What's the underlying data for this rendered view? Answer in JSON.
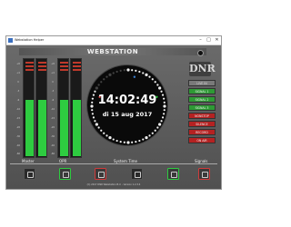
{
  "window": {
    "title": "Webstation Helper"
  },
  "app": {
    "logo": "WEBSTATION",
    "brand": "DNR",
    "time": "14:02:49",
    "date": "di 15 aug 2017",
    "meters": {
      "scale": [
        "+8",
        "+4",
        "0",
        "-3",
        "-6",
        "-10",
        "-15",
        "-20",
        "-30",
        "-40",
        "-60"
      ]
    },
    "signals": [
      {
        "label": "LIVE IN",
        "state": "grey"
      },
      {
        "label": "SIGNAL 1",
        "state": "green"
      },
      {
        "label": "SIGNAL 2",
        "state": "green"
      },
      {
        "label": "SIGNAL 3",
        "state": "green"
      },
      {
        "label": "NONSTOP",
        "state": "red"
      },
      {
        "label": "SILENCE",
        "state": "red"
      },
      {
        "label": "RECORD",
        "state": "red"
      },
      {
        "label": "ON AIR",
        "state": "red"
      }
    ],
    "labels": {
      "master": "Master",
      "opr": "OPR",
      "system_time": "System Time",
      "signals": "Signals"
    },
    "footer": "(C) 2017 DNR Webstation B.V. - Version 1.2.3.4",
    "colors": {
      "meter_green": "#2ecc40",
      "meter_red": "#c0392b",
      "signal_green": "#2e9a35",
      "signal_red": "#b52222"
    }
  }
}
